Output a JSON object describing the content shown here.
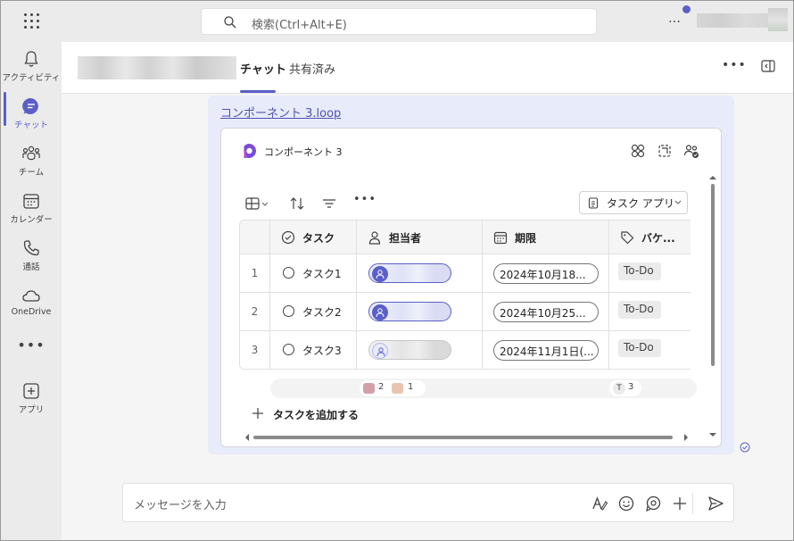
{
  "search": {
    "placeholder": "検索(Ctrl+Alt+E)"
  },
  "top": {
    "more": "…"
  },
  "rail": {
    "items": [
      {
        "label": "アクティビティ",
        "icon": "bell-icon"
      },
      {
        "label": "チャット",
        "icon": "chat-icon"
      },
      {
        "label": "チーム",
        "icon": "teams-icon"
      },
      {
        "label": "カレンダー",
        "icon": "calendar-icon"
      },
      {
        "label": "通話",
        "icon": "phone-icon"
      },
      {
        "label": "OneDrive",
        "icon": "cloud-icon"
      },
      {
        "label": "アプリ",
        "icon": "apps-icon"
      }
    ],
    "more": "•••"
  },
  "header": {
    "tabs": [
      "チャット",
      "共有済み"
    ],
    "more": "•••"
  },
  "message": {
    "link": "コンポーネント 3.loop",
    "card": {
      "title": "コンポーネント 3",
      "toolbar_more": "•••",
      "task_app_button": "タスク アプリ",
      "columns": [
        "タスク",
        "担当者",
        "期限",
        "バケ..."
      ],
      "rows": [
        {
          "num": "1",
          "task": "タスク1",
          "due": "2024年10月18...",
          "bucket": "To-Do"
        },
        {
          "num": "2",
          "task": "タスク2",
          "due": "2024年10月25...",
          "bucket": "To-Do"
        },
        {
          "num": "3",
          "task": "タスク3",
          "due": "2024年11月1日(...",
          "bucket": "To-Do"
        }
      ],
      "summary": {
        "chip1": "2",
        "chip2": "1",
        "bucket_letter": "T",
        "bucket_count": "3"
      },
      "add_task": "タスクを追加する"
    }
  },
  "compose": {
    "placeholder": "メッセージを入力"
  },
  "colors": {
    "accent": "#5b5fc7",
    "bubble": "#e8ebfa"
  }
}
